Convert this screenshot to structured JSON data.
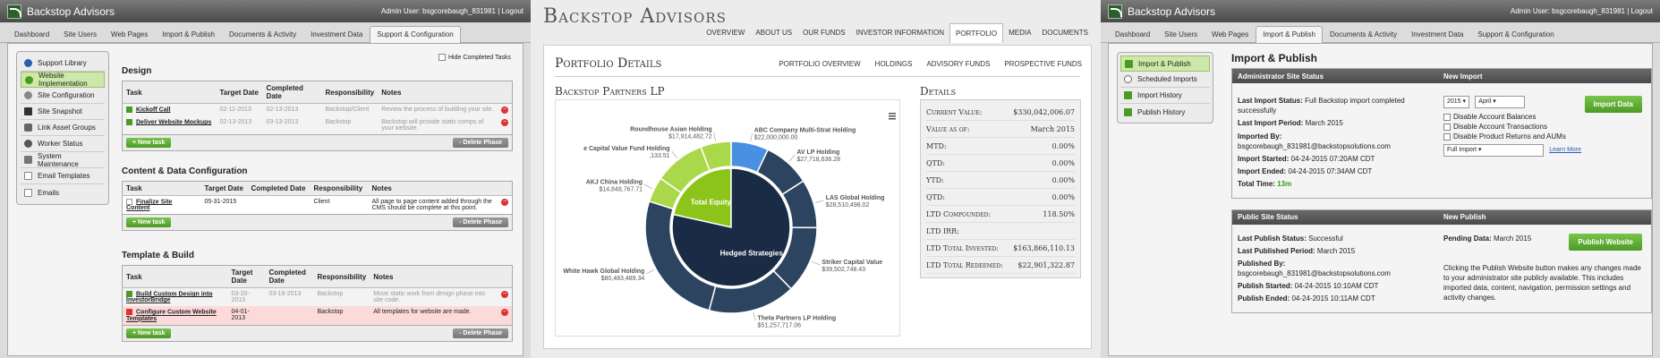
{
  "p1": {
    "app_title": "Backstop Advisors",
    "user": "Admin User: bsgcorebaugh_831981 | Logout",
    "tabs": [
      "Dashboard",
      "Site Users",
      "Web Pages",
      "Import & Publish",
      "Documents & Activity",
      "Investment Data",
      "Support & Configuration"
    ],
    "nav": [
      "Support Library",
      "Website Implementation",
      "Site Configuration",
      "Site Snapshot",
      "Link Asset Groups",
      "Worker Status",
      "System Maintenance",
      "Email Templates",
      "Emails"
    ],
    "hide_completed": "Hide Completed Tasks",
    "design": {
      "title": "Design",
      "headers": [
        "Task",
        "Target Date",
        "Completed Date",
        "Responsibility",
        "Notes"
      ],
      "rows": [
        {
          "task": "Kickoff Call",
          "target": "02-11-2013",
          "completed": "02-13-2013",
          "resp": "Backstop/Client",
          "notes": "Review the process of building your site."
        },
        {
          "task": "Deliver Website Mockups",
          "target": "02-13-2013",
          "completed": "03-13-2013",
          "resp": "Backstop",
          "notes": "Backstop will provide static comps of your website."
        }
      ]
    },
    "content": {
      "title": "Content & Data Configuration",
      "headers": [
        "Task",
        "Target Date",
        "Completed Date",
        "Responsibility",
        "Notes"
      ],
      "rows": [
        {
          "task": "Finalize Site Content",
          "target": "05-31-2015",
          "completed": "",
          "resp": "Client",
          "notes": "All page to page content added through the CMS should be complete at this point."
        }
      ]
    },
    "template": {
      "title": "Template & Build",
      "headers": [
        "Task",
        "Target Date",
        "Completed Date",
        "Responsibility",
        "Notes"
      ],
      "rows": [
        {
          "task": "Build Custom Design into InvestorBridge",
          "target": "03-20-2013",
          "completed": "03-18-2013",
          "resp": "Backstop",
          "notes": "Move static work from design phase into site code."
        },
        {
          "task": "Configure Custom Website Templates",
          "target": "04-01-2013",
          "completed": "",
          "resp": "Backstop",
          "notes": "All templates for website are made."
        }
      ]
    },
    "new_task": "+ New task",
    "delete_phase": "- Delete Phase"
  },
  "p2": {
    "brand": "Backstop Advisors",
    "topnav": [
      "OVERVIEW",
      "ABOUT US",
      "OUR FUNDS",
      "INVESTOR INFORMATION",
      "PORTFOLIO",
      "MEDIA",
      "DOCUMENTS"
    ],
    "page_title": "Portfolio Details",
    "subnav": [
      "PORTFOLIO OVERVIEW",
      "HOLDINGS",
      "ADVISORY FUNDS",
      "PROSPECTIVE FUNDS"
    ],
    "fund_title": "Backstop Partners LP",
    "details_title": "Details",
    "details": [
      {
        "label": "Current Value:",
        "value": "$330,042,006.07"
      },
      {
        "label": "Value as of:",
        "value": "March 2015"
      },
      {
        "label": "MTD:",
        "value": "0.00%"
      },
      {
        "label": "QTD:",
        "value": "0.00%"
      },
      {
        "label": "YTD:",
        "value": "0.00%"
      },
      {
        "label": "QTD:",
        "value": "0.00%"
      },
      {
        "label": "LTD Compounded:",
        "value": "118.50%"
      },
      {
        "label": "LTD IRR:",
        "value": ""
      },
      {
        "label": "LTD Total Invested:",
        "value": "$163,866,110.13"
      },
      {
        "label": "LTD Total Redeemed:",
        "value": "$22,901,322.87"
      }
    ]
  },
  "chart_data": {
    "type": "pie",
    "inner": [
      {
        "name": "Total Equity",
        "value": 21.5,
        "color": "#8cc41a"
      },
      {
        "name": "Hedged Strategies",
        "value": 78.5,
        "color": "#1a2c45"
      }
    ],
    "outer": [
      {
        "name": "ABC Company Multi-Strat Holding",
        "amount": "$22,000,000.00",
        "value": 22000000,
        "color": "#4a90e2"
      },
      {
        "name": "AV LP Holding",
        "amount": "$27,718,636.28",
        "value": 27718636,
        "color": "#2d4460"
      },
      {
        "name": "LAS Global Holding",
        "amount": "$28,510,498.02",
        "value": 28510498,
        "color": "#2d4460"
      },
      {
        "name": "Striker Capital Value",
        "amount": "$39,502,748.43",
        "value": 39502748,
        "color": "#2d4460"
      },
      {
        "name": "Theta Partners LP Holding",
        "amount": "$51,257,717.06",
        "value": 51257717,
        "color": "#2d4460"
      },
      {
        "name": "White Hawk Global Holding",
        "amount": "$80,483,489.34",
        "value": 80483489,
        "color": "#2d4460"
      },
      {
        "name": "AKJ China Holding",
        "amount": "$14,848,767.71",
        "value": 14848767,
        "color": "#a9d94a"
      },
      {
        "name": "e Capital Value Fund Holding",
        "amount": ",133.51",
        "value": 30000000,
        "color": "#a9d94a"
      },
      {
        "name": "Roundhouse Asian Holding",
        "amount": "$17,914,482.72",
        "value": 17914482,
        "color": "#a9d94a"
      }
    ]
  },
  "p3": {
    "app_title": "Backstop Advisors",
    "user": "Admin User: bsgcorebaugh_831981 | Logout",
    "tabs": [
      "Dashboard",
      "Site Users",
      "Web Pages",
      "Import & Publish",
      "Documents & Activity",
      "Investment Data",
      "Support & Configuration"
    ],
    "nav": [
      "Import & Publish",
      "Scheduled Imports",
      "Import History",
      "Publish History"
    ],
    "title": "Import & Publish",
    "admin": {
      "header_left": "Administrator Site Status",
      "header_right": "New Import",
      "last_import_status_label": "Last Import Status:",
      "last_import_status": "Full Backstop import completed successfully",
      "last_import_period_label": "Last Import Period:",
      "last_import_period": "March 2015",
      "imported_by_label": "Imported By:",
      "imported_by": "bsgcorebaugh_831981@backstopsolutions.com",
      "import_started_label": "Import Started:",
      "import_started": "04-24-2015 07:20AM CDT",
      "import_ended_label": "Import Ended:",
      "import_ended": "04-24-2015 07:34AM CDT",
      "total_time_label": "Total Time:",
      "total_time": "13m",
      "year": "2015",
      "month": "April",
      "import_button": "Import Data",
      "checkboxes": [
        "Disable Account Balances",
        "Disable Account Transactions",
        "Disable Product Returns and AUMs"
      ],
      "import_type": "Full Import",
      "learn_more": "Learn More"
    },
    "public": {
      "header_left": "Public Site Status",
      "header_right": "New Publish",
      "last_publish_status_label": "Last Publish Status:",
      "last_publish_status": "Successful",
      "last_published_period_label": "Last Published Period:",
      "last_published_period": "March 2015",
      "published_by_label": "Published By:",
      "published_by": "bsgcorebaugh_831981@backstopsolutions.com",
      "publish_started_label": "Publish Started:",
      "publish_started": "04-24-2015 10:10AM CDT",
      "publish_ended_label": "Publish Ended:",
      "publish_ended": "04-24-2015 10:11AM CDT",
      "pending_label": "Pending Data:",
      "pending": "March 2015",
      "publish_button": "Publish Website",
      "description": "Clicking the Publish Website button makes any changes made to your administrator site publicly available. This includes imported data, content, navigation, permission settings and activity changes."
    }
  }
}
